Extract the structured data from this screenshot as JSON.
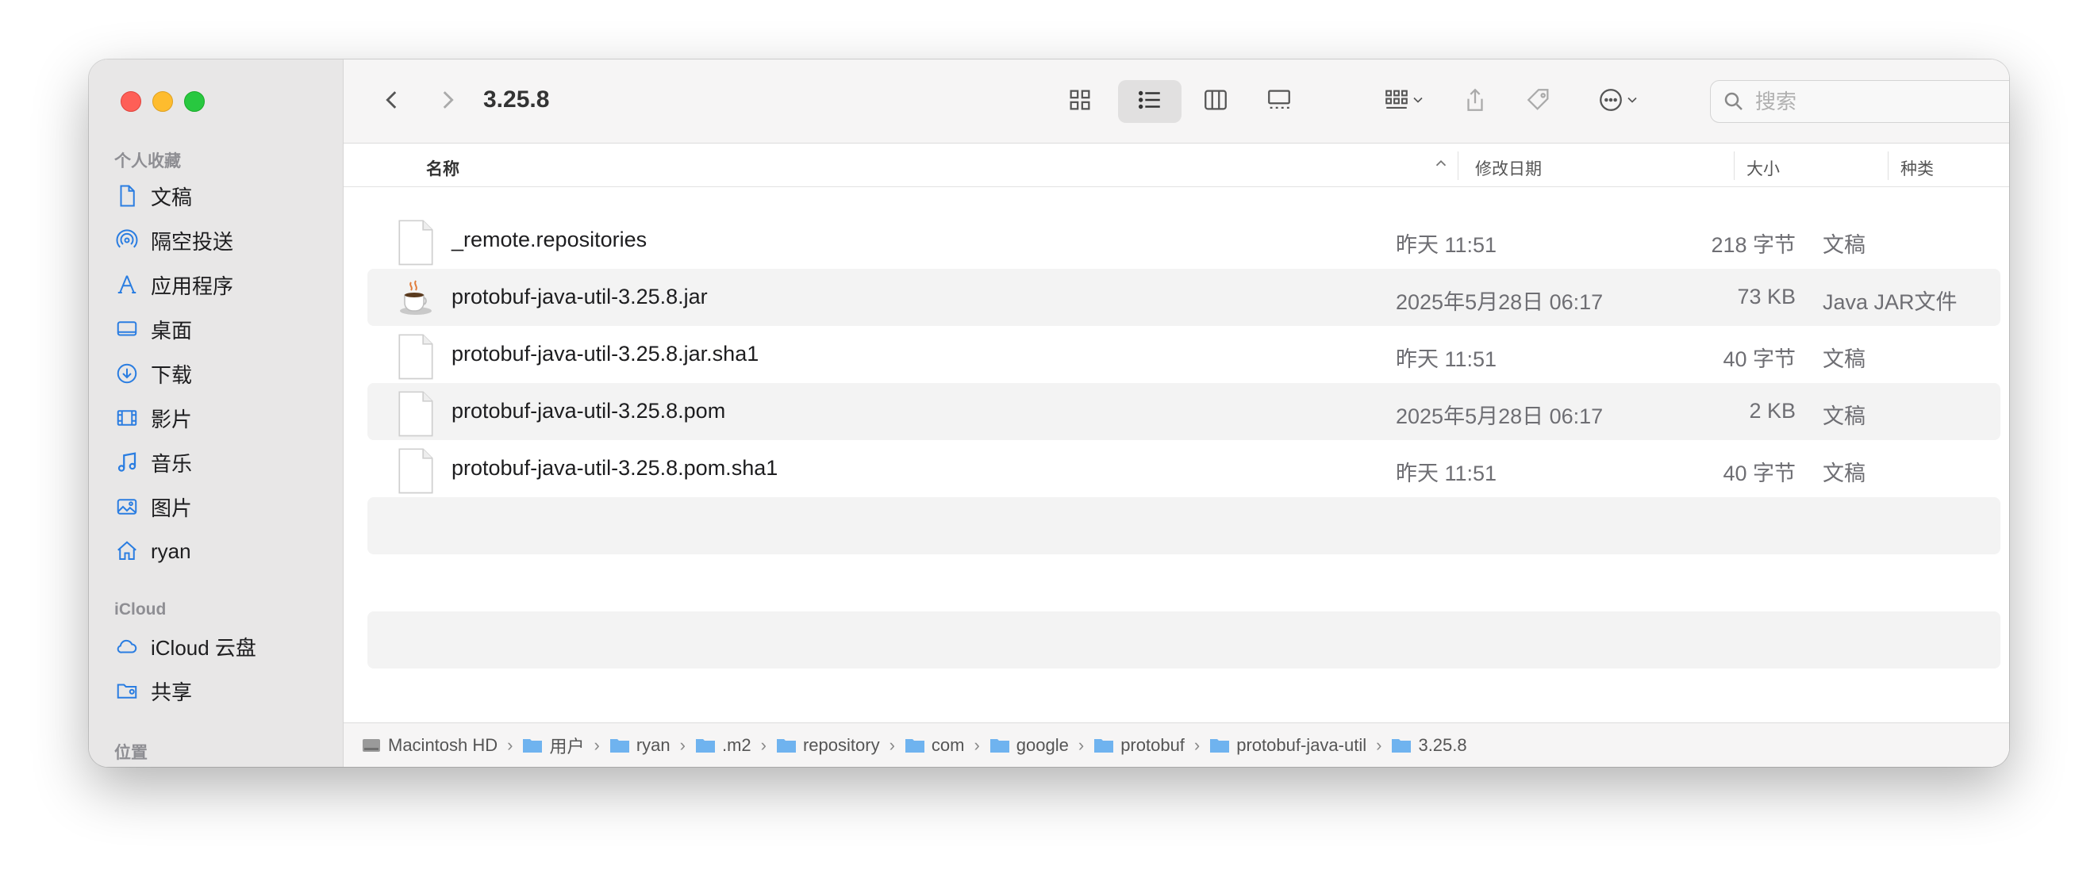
{
  "window": {
    "title": "3.25.8"
  },
  "sidebar": {
    "favorites_header": "个人收藏",
    "favorites": [
      {
        "label": "文稿",
        "icon": "document-icon"
      },
      {
        "label": "隔空投送",
        "icon": "airdrop-icon"
      },
      {
        "label": "应用程序",
        "icon": "applications-icon"
      },
      {
        "label": "桌面",
        "icon": "desktop-icon"
      },
      {
        "label": "下载",
        "icon": "download-icon"
      },
      {
        "label": "影片",
        "icon": "movies-icon"
      },
      {
        "label": "音乐",
        "icon": "music-icon"
      },
      {
        "label": "图片",
        "icon": "pictures-icon"
      },
      {
        "label": "ryan",
        "icon": "home-icon"
      }
    ],
    "icloud_header": "iCloud",
    "icloud": [
      {
        "label": "iCloud 云盘",
        "icon": "cloud-icon"
      },
      {
        "label": "共享",
        "icon": "shared-folder-icon"
      }
    ],
    "locations_header": "位置"
  },
  "toolbar": {
    "search_placeholder": "搜索"
  },
  "columns": {
    "name": "名称",
    "date": "修改日期",
    "size": "大小",
    "kind": "种类"
  },
  "files": [
    {
      "name": "_remote.repositories",
      "date": "昨天 11:51",
      "size": "218 字节",
      "kind": "文稿",
      "icon": "document-file-icon"
    },
    {
      "name": "protobuf-java-util-3.25.8.jar",
      "date": "2025年5月28日 06:17",
      "size": "73 KB",
      "kind": "Java JAR文件",
      "icon": "java-jar-icon"
    },
    {
      "name": "protobuf-java-util-3.25.8.jar.sha1",
      "date": "昨天 11:51",
      "size": "40 字节",
      "kind": "文稿",
      "icon": "document-file-icon"
    },
    {
      "name": "protobuf-java-util-3.25.8.pom",
      "date": "2025年5月28日 06:17",
      "size": "2 KB",
      "kind": "文稿",
      "icon": "document-file-icon"
    },
    {
      "name": "protobuf-java-util-3.25.8.pom.sha1",
      "date": "昨天 11:51",
      "size": "40 字节",
      "kind": "文稿",
      "icon": "document-file-icon"
    }
  ],
  "pathbar": [
    "Macintosh HD",
    "用户",
    "ryan",
    ".m2",
    "repository",
    "com",
    "google",
    "protobuf",
    "protobuf-java-util",
    "3.25.8"
  ]
}
